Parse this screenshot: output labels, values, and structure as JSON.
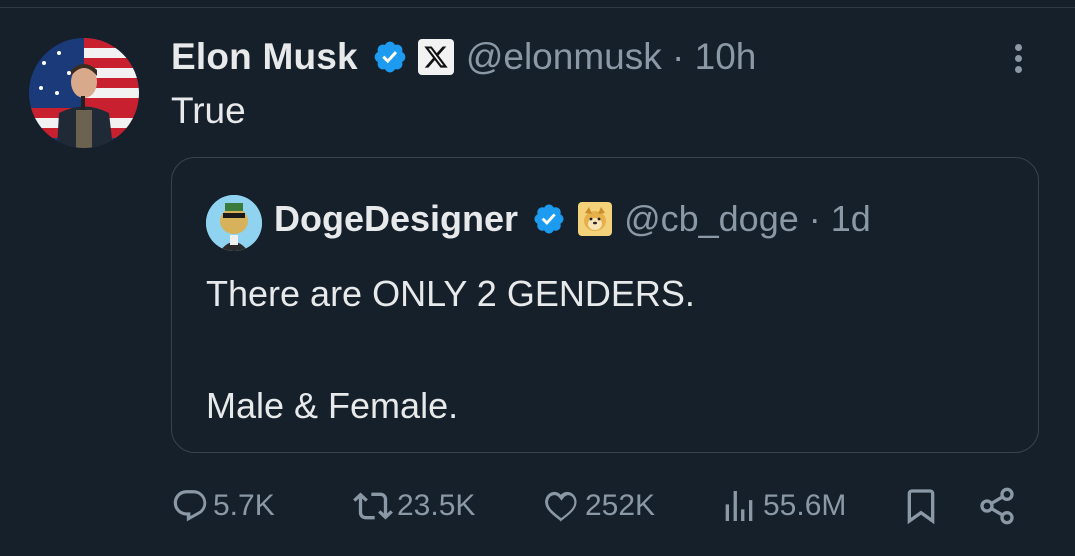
{
  "tweet": {
    "author_name": "Elon Musk",
    "handle": "@elonmusk",
    "separator": " · ",
    "time": "10h",
    "text": "True"
  },
  "quoted": {
    "author_name": "DogeDesigner",
    "handle": "@cb_doge",
    "separator": " · ",
    "time": "1d",
    "line1": "There are ONLY 2 GENDERS.",
    "line2": "Male & Female."
  },
  "actions": {
    "replies": "5.7K",
    "reposts": "23.5K",
    "likes": "252K",
    "views": "55.6M"
  },
  "icons": {
    "verified": "verified-badge-icon",
    "x_logo": "x-logo-icon",
    "more": "more-options-icon",
    "reply": "reply-icon",
    "repost": "repost-icon",
    "like": "heart-icon",
    "views": "views-chart-icon",
    "bookmark": "bookmark-icon",
    "share": "share-icon"
  },
  "colors": {
    "background": "#15202b",
    "primary_text": "#e7e9ea",
    "secondary_text": "#8b98a5",
    "verified_blue": "#1d9bf0",
    "border": "#38444d"
  }
}
